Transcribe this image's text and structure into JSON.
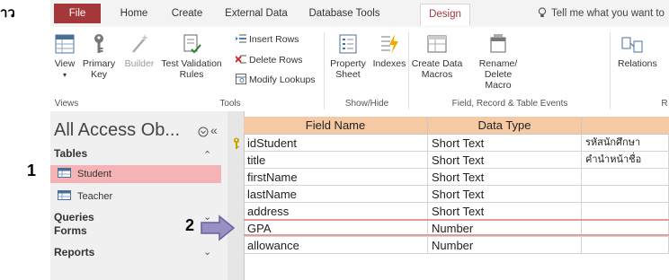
{
  "corner_label": "าว",
  "tabs": [
    {
      "label": "File"
    },
    {
      "label": "Home"
    },
    {
      "label": "Create"
    },
    {
      "label": "External Data"
    },
    {
      "label": "Database Tools"
    },
    {
      "label": "Design"
    }
  ],
  "tell_me": "Tell me what you want to do.",
  "ribbon": {
    "view": "View",
    "primary_key": "Primary Key",
    "builder": "Builder",
    "test_validation": "Test Validation Rules",
    "insert_rows": "Insert Rows",
    "delete_rows": "Delete Rows",
    "modify_lookups": "Modify Lookups",
    "property_sheet": "Property Sheet",
    "indexes": "Indexes",
    "create_data_macros": "Create Data Macros",
    "rename_delete_macro": "Rename/ Delete Macro",
    "relationships": "Relations",
    "groups": {
      "views": "Views",
      "tools": "Tools",
      "show_hide": "Show/Hide",
      "field_events": "Field, Record & Table Events",
      "rel": "R"
    }
  },
  "annotations": {
    "one": "1",
    "two": "2"
  },
  "nav": {
    "title": "All Access Ob...",
    "tables_header": "Tables",
    "tables": [
      {
        "label": "Student",
        "selected": true
      },
      {
        "label": "Teacher",
        "selected": false
      }
    ],
    "queries": "Queries",
    "forms": "Forms",
    "reports": "Reports"
  },
  "grid": {
    "headers": {
      "field_name": "Field Name",
      "data_type": "Data Type"
    },
    "rows": [
      {
        "field": "idStudent",
        "type": "Short Text",
        "desc": "รหัสนักศึกษา",
        "primary_key": true
      },
      {
        "field": "title",
        "type": "Short Text",
        "desc": "คำนำหน้าชื่อ"
      },
      {
        "field": "firstName",
        "type": "Short Text",
        "desc": ""
      },
      {
        "field": "lastName",
        "type": "Short Text",
        "desc": ""
      },
      {
        "field": "address",
        "type": "Short Text",
        "desc": "",
        "highlighted": true
      },
      {
        "field": "GPA",
        "type": "Number",
        "desc": ""
      },
      {
        "field": "allowance",
        "type": "Number",
        "desc": ""
      }
    ]
  },
  "colors": {
    "accent": "#a4373a",
    "header_fill": "#f5c9a3",
    "selection": "#f4b3b5",
    "arrow": "#9a8fc2"
  }
}
